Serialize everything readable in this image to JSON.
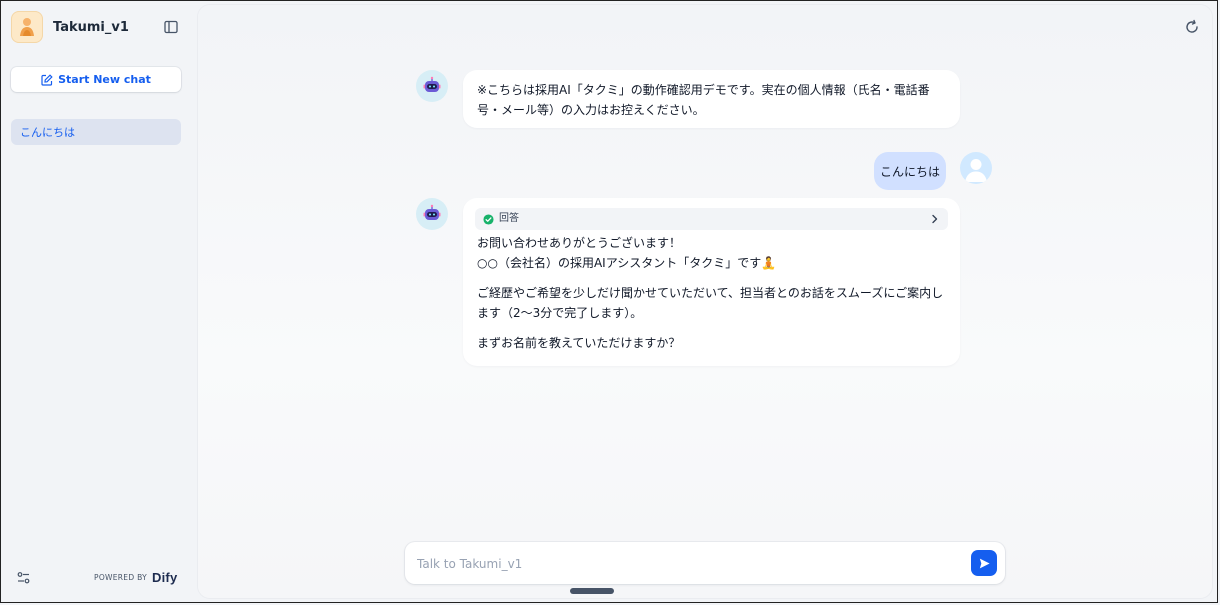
{
  "app": {
    "title": "Takumi_v1"
  },
  "sidebar": {
    "new_chat_label": "Start New chat",
    "conversations": [
      {
        "label": "こんにちは"
      }
    ],
    "powered_by": "POWERED BY",
    "brand": "Dify"
  },
  "chat": {
    "intro": "※こちらは採用AI「タクミ」の動作確認用デモです。実在の個人情報（氏名・電話番号・メール等）の入力はお控えください。",
    "user_message": "こんにちは",
    "answer_label": "回答",
    "answer_lines": [
      "お問い合わせありがとうございます！",
      "○○（会社名）の採用AIアシスタント「タクミ」です🧘",
      "ご経歴やご希望を少しだけ聞かせていただいて、担当者とのお話をスムーズにご案内します（2〜3分で完了します）。",
      "まずお名前を教えていただけますか？"
    ]
  },
  "input": {
    "placeholder": "Talk to Takumi_v1",
    "value": ""
  },
  "colors": {
    "accent": "#155eef",
    "user_bubble": "#d1e0ff",
    "selected_item": "#dde3f0"
  },
  "icons": {
    "sidebar_toggle": "panel-left-icon",
    "new_chat": "edit-icon",
    "reset": "refresh-icon",
    "settings": "sliders-icon",
    "check": "check-circle-icon",
    "chevron": "chevron-right-icon",
    "send": "send-icon"
  }
}
